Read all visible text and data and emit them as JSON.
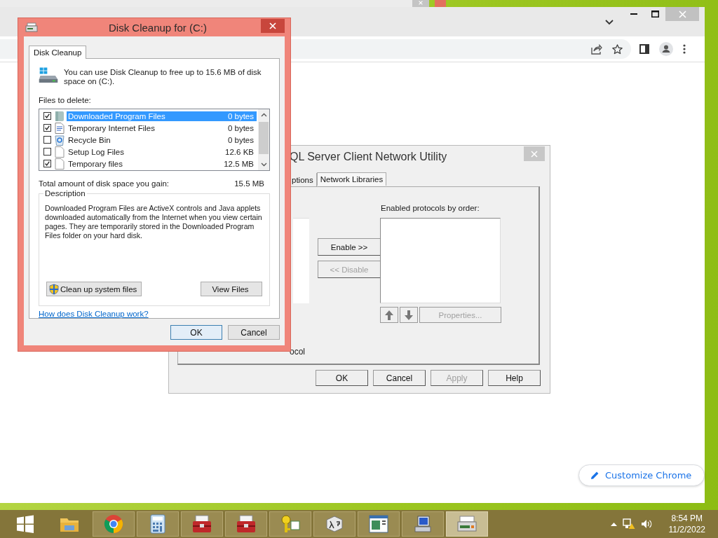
{
  "chrome": {
    "customize_button": "Customize Chrome"
  },
  "sql_window": {
    "title": "QL Server Client Network Utility",
    "tabs": [
      {
        "label": "ptions",
        "selected": false
      },
      {
        "label": "Network Libraries",
        "selected": true
      }
    ],
    "enabled_label": "Enabled protocols by order:",
    "enable_buttons": [
      {
        "label": "Enable >>",
        "disabled": false
      },
      {
        "label": "<< Disable",
        "disabled": true
      }
    ],
    "move_buttons": [
      {
        "kind": "up"
      },
      {
        "kind": "down"
      }
    ],
    "properties_button": {
      "label": "Properties...",
      "disabled": true
    },
    "partial_label": "ocol",
    "buttons": [
      {
        "label": "OK",
        "disabled": false
      },
      {
        "label": "Cancel",
        "disabled": false
      },
      {
        "label": "Apply",
        "disabled": true
      },
      {
        "label": "Help",
        "disabled": false
      }
    ]
  },
  "disk_cleanup": {
    "title": "Disk Cleanup for  (C:)",
    "tab": "Disk Cleanup",
    "intro": "You can use Disk Cleanup to free up to 15.6 MB of disk space on  (C:).",
    "files_label": "Files to delete:",
    "files": [
      {
        "kind": "folder",
        "name": "Downloaded Program Files",
        "size": "0 bytes",
        "checked": true,
        "selected": true
      },
      {
        "kind": "document",
        "name": "Temporary Internet Files",
        "size": "0 bytes",
        "checked": true,
        "selected": false
      },
      {
        "kind": "recycle",
        "name": "Recycle Bin",
        "size": "0 bytes",
        "checked": false,
        "selected": false
      },
      {
        "kind": "file",
        "name": "Setup Log Files",
        "size": "12.6 KB",
        "checked": false,
        "selected": false
      },
      {
        "kind": "file",
        "name": "Temporary files",
        "size": "12.5 MB",
        "checked": true,
        "selected": false
      }
    ],
    "total_label": "Total amount of disk space you gain:",
    "total_value": "15.5 MB",
    "description_heading": "Description",
    "description": "Downloaded Program Files are ActiveX controls and Java applets downloaded automatically from the Internet when you view certain pages. They are temporarily stored in the Downloaded Program Files folder on your hard disk.",
    "actions": [
      {
        "label": "Clean up system files",
        "shield": true
      },
      {
        "label": "View Files",
        "shield": false
      }
    ],
    "help_link": "How does Disk Cleanup work?",
    "buttons": [
      {
        "label": "OK",
        "default": true
      },
      {
        "label": "Cancel",
        "default": false
      }
    ]
  },
  "taskbar": {
    "apps": [
      {
        "kind": "start",
        "open": false,
        "selected": false
      },
      {
        "kind": "explorer",
        "open": false,
        "selected": false
      },
      {
        "kind": "chrome",
        "open": true,
        "selected": false
      },
      {
        "kind": "calculator",
        "open": true,
        "selected": false
      },
      {
        "kind": "toolbox",
        "open": true,
        "selected": false
      },
      {
        "kind": "toolbox",
        "open": true,
        "selected": false
      },
      {
        "kind": "keys",
        "open": true,
        "selected": false
      },
      {
        "kind": "lambda",
        "open": true,
        "selected": false
      },
      {
        "kind": "window",
        "open": true,
        "selected": false
      },
      {
        "kind": "network",
        "open": true,
        "selected": false
      },
      {
        "kind": "cleanup",
        "open": true,
        "selected": true
      }
    ],
    "time": "8:54 PM",
    "date": "11/2/2022"
  }
}
